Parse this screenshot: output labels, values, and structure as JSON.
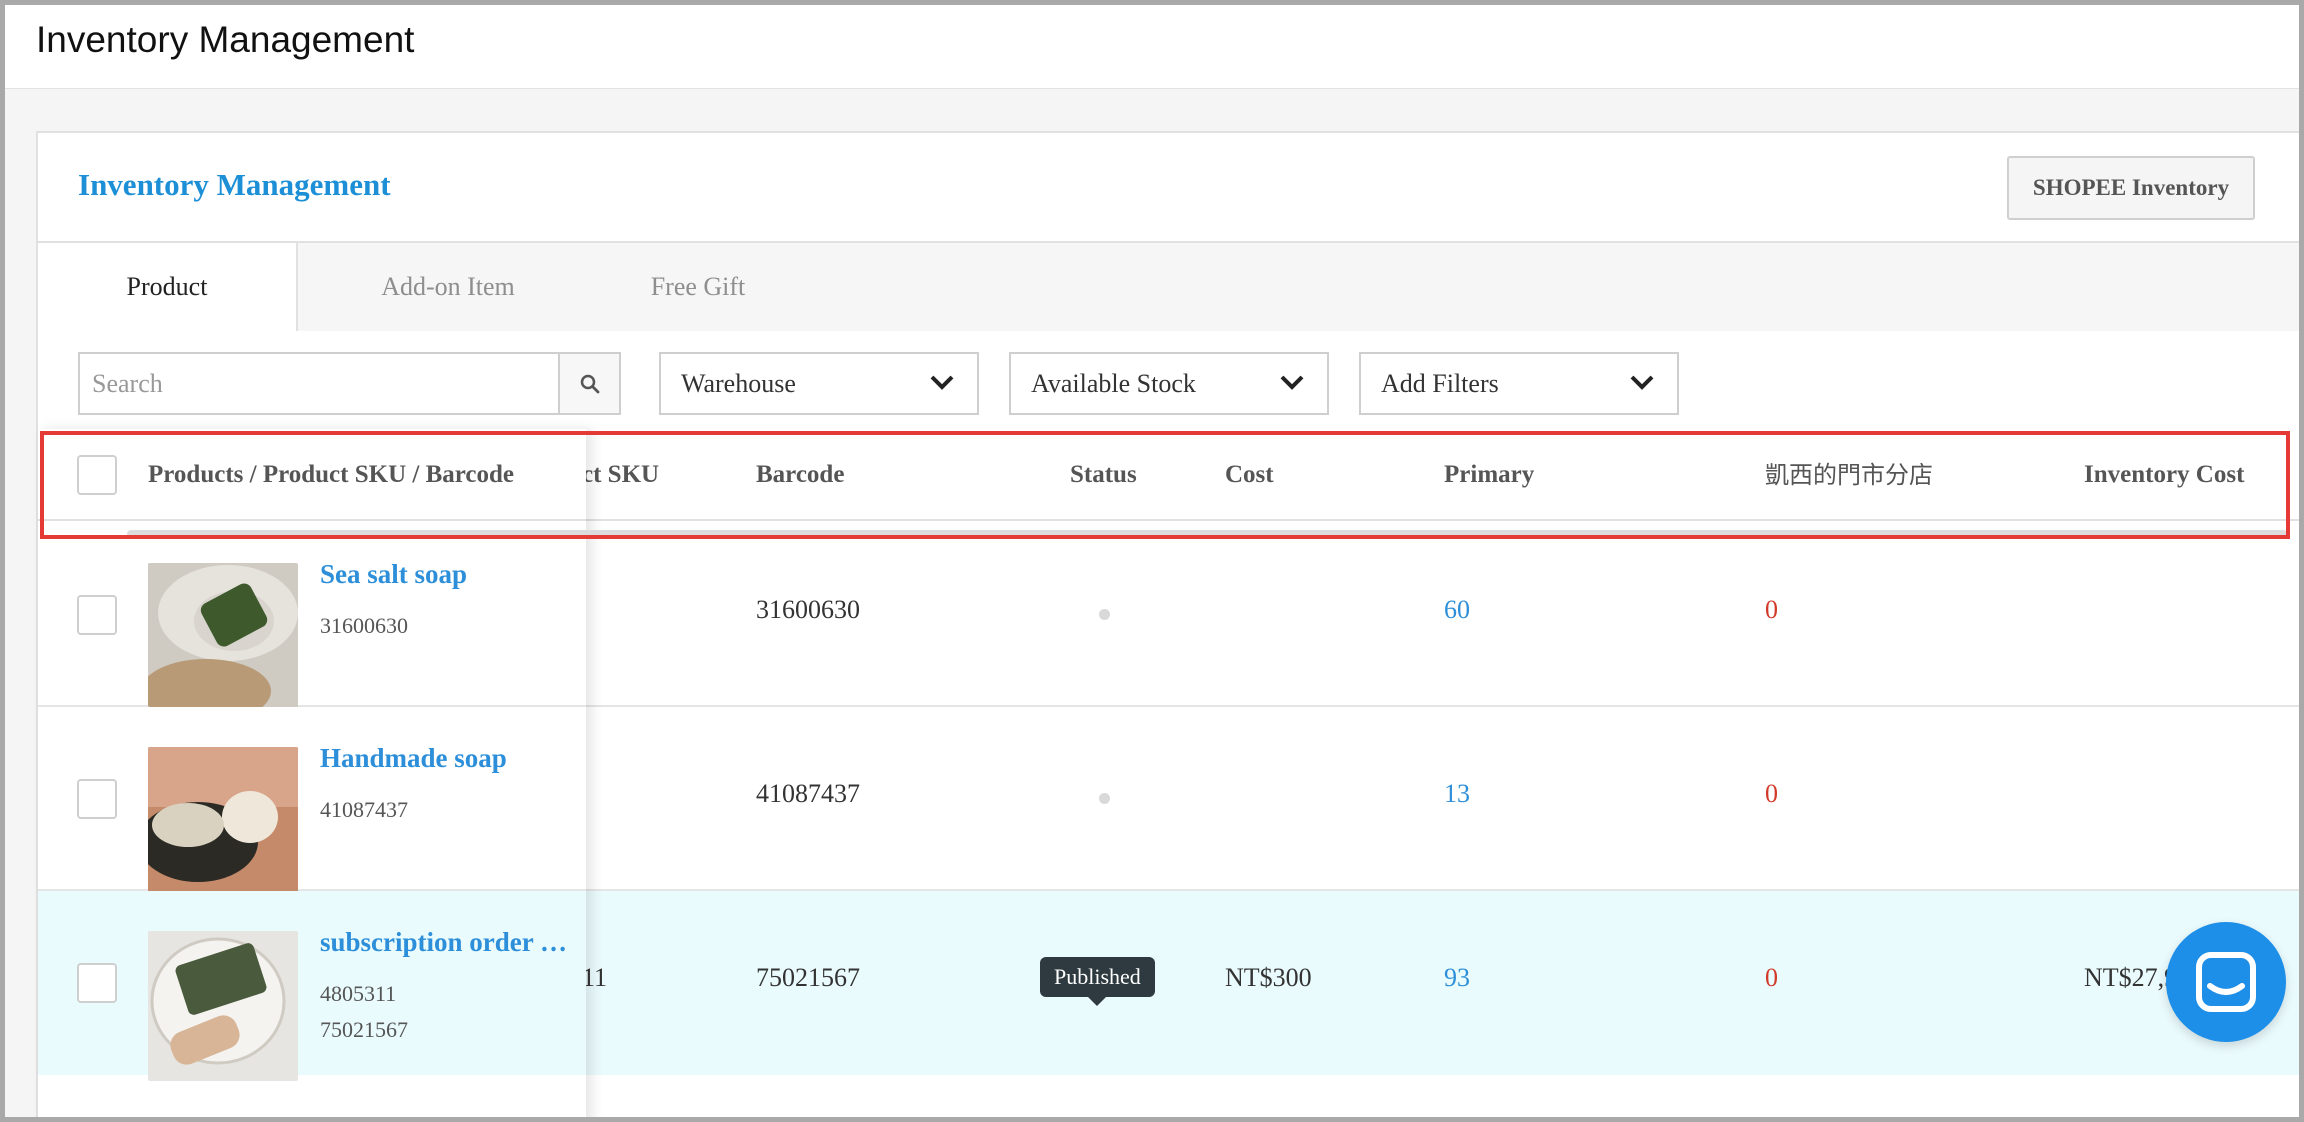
{
  "app": {
    "title": "Inventory Management"
  },
  "card": {
    "title": "Inventory Management",
    "shopee_button": "SHOPEE Inventory"
  },
  "tabs": [
    {
      "label": "Product",
      "active": true
    },
    {
      "label": "Add-on Item",
      "active": false
    },
    {
      "label": "Free Gift",
      "active": false
    }
  ],
  "filters": {
    "search_placeholder": "Search",
    "warehouse": "Warehouse",
    "available_stock": "Available Stock",
    "add_filters": "Add Filters"
  },
  "table": {
    "columns": {
      "product": "Products / Product SKU / Barcode",
      "product_sku_partial": "ct SKU",
      "barcode": "Barcode",
      "status": "Status",
      "cost": "Cost",
      "primary": "Primary",
      "store": "凱西的門市分店",
      "inventory_cost": "Inventory Cost"
    },
    "rows": [
      {
        "name": "Sea salt soap",
        "sku": "31600630",
        "barcode_sub": "",
        "sku_partial": "",
        "barcode": "31600630",
        "status": "unpublished",
        "cost": "",
        "primary": "60",
        "store": "0",
        "inventory_cost": ""
      },
      {
        "name": "Handmade soap",
        "sku": "41087437",
        "barcode_sub": "",
        "sku_partial": "",
        "barcode": "41087437",
        "status": "unpublished",
        "cost": "",
        "primary": "13",
        "store": "0",
        "inventory_cost": ""
      },
      {
        "name": "subscription order …",
        "sku": "4805311",
        "barcode_sub": "75021567",
        "sku_partial": "11",
        "barcode": "75021567",
        "status": "published",
        "cost": "NT$300",
        "primary": "93",
        "store": "0",
        "inventory_cost": "NT$27,9"
      }
    ]
  },
  "tooltip": {
    "text": "Published"
  },
  "colors": {
    "accent": "#1c8fd6",
    "link": "#2d8fd9",
    "danger": "#d23a2a",
    "highlight": "#e53935",
    "published": "#4caf50",
    "row_highlight": "#eafbfd"
  },
  "icons": {
    "search": "search-icon",
    "chevron": "chevron-down-icon",
    "chat": "chat-icon"
  }
}
